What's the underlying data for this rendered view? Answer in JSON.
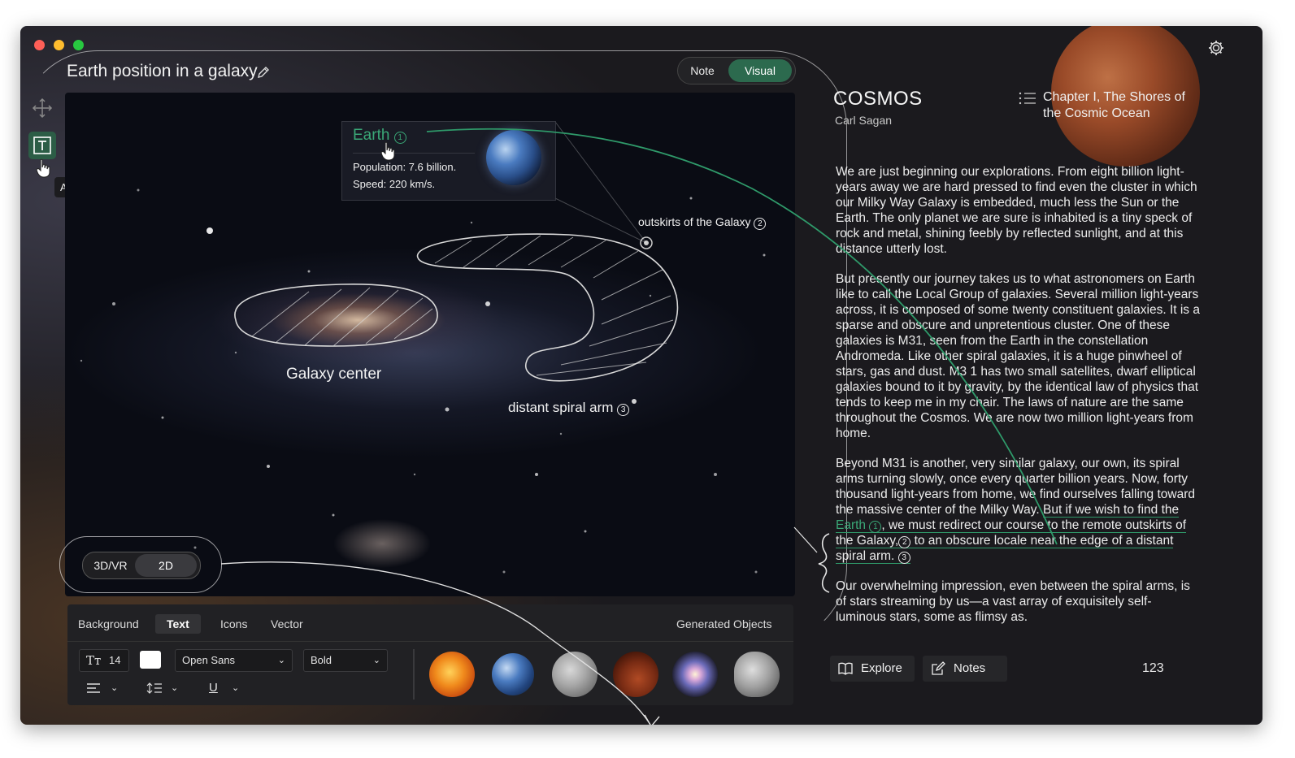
{
  "document": {
    "title": "Earth position in a galaxy"
  },
  "mode_toggle": {
    "note": "Note",
    "visual": "Visual"
  },
  "tools": {
    "tooltip": "Add Text"
  },
  "canvas": {
    "earth_card": {
      "name": "Earth",
      "num": "1",
      "population": "Population: 7.6 billion.",
      "speed": "Speed: 220 km/s."
    },
    "labels": {
      "outskirts": "outskirts of the Galaxy",
      "outskirts_num": "2",
      "galaxy_center": "Galaxy center",
      "spiral_arm": "distant spiral arm",
      "spiral_num": "3"
    }
  },
  "view_toggle": {
    "option_3d": "3D/VR",
    "option_2d": "2D"
  },
  "editor": {
    "tabs": [
      "Background",
      "Text",
      "Icons",
      "Vector"
    ],
    "active_tab": "Text",
    "generated_label": "Generated Objects",
    "font_size": "14",
    "font_family": "Open Sans",
    "font_weight": "Bold",
    "text_color": "#ffffff",
    "objects": [
      "sun",
      "earth",
      "moon",
      "blood-moon",
      "spiral-galaxy",
      "asteroid"
    ]
  },
  "book": {
    "title": "COSMOS",
    "author": "Carl Sagan",
    "chapter": "Chapter I, The Shores of the Cosmic Ocean",
    "paragraphs": [
      "We are just beginning our explorations. From eight billion light-years away we are hard pressed to find even the cluster in which our Milky Way Galaxy is embedded, much less the Sun or the Earth. The only planet we are sure is inhabited is a tiny speck of rock and metal, shining feebly by reflected sunlight, and at this distance utterly lost.",
      "But presently our journey takes us to what astronomers on Earth like to call the Local Group of galaxies. Several million light-years across, it is composed of some twenty constituent galaxies. It is a sparse and obscure and unpretentious cluster. One of these galaxies is M31, seen from the Earth in the constellation Andromeda. Like other spiral galaxies, it is a huge pinwheel of stars, gas and dust. M3 1 has two small satellites, dwarf elliptical galaxies bound to it by gravity, by the identical law of physics that tends to keep me in my chair. The laws of nature are the same throughout the Cosmos. We are now two million light-years from home."
    ],
    "p3_start": "Beyond M31 is another, very similar galaxy, our own, its spiral arms turning slowly, once every quarter billion years. Now, forty thousand light-years from home, we find ourselves falling toward the massive center of the Milky Way. ",
    "p3_hl_a": "But if we wish to find the ",
    "p3_hl_earth": "Earth",
    "p3_hl_n1": "1",
    "p3_hl_b": ", we must redirect our course to the remote outskirts of the Galaxy,",
    "p3_hl_n2": "2",
    "p3_hl_c": " to an obscure locale near the edge of a distant spiral arm.",
    "p3_hl_n3": "3",
    "paragraph_last": "Our overwhelming impression, even between the spiral arms, is of stars streaming by us—a vast array of exquisitely self-luminous stars, some as flimsy as.",
    "explore_label": "Explore",
    "notes_label": "Notes",
    "page_number": "123"
  },
  "colors": {
    "accent_green": "#2f9a6a",
    "visual_toggle": "#2c6a4e",
    "window_bg": "#1b1a1e"
  }
}
